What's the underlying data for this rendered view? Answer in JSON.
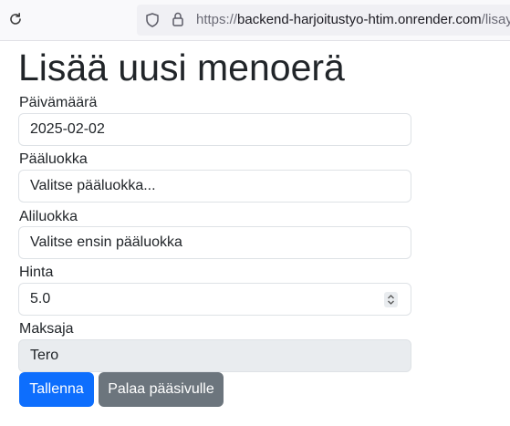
{
  "browser": {
    "url_prefix": "https://",
    "url_host": "backend-harjoitustyo-htim.onrender.com",
    "url_path": "/lisays"
  },
  "page": {
    "title": "Lisää uusi menoerä"
  },
  "form": {
    "date": {
      "label": "Päivämäärä",
      "value": "2025-02-02"
    },
    "main_category": {
      "label": "Pääluokka",
      "value": "Valitse pääluokka..."
    },
    "sub_category": {
      "label": "Aliluokka",
      "value": "Valitse ensin pääluokka"
    },
    "price": {
      "label": "Hinta",
      "value": "5.0"
    },
    "payer": {
      "label": "Maksaja",
      "value": "Tero"
    }
  },
  "buttons": {
    "save": "Tallenna",
    "back": "Palaa pääsivulle"
  },
  "colors": {
    "primary": "#0d6efd",
    "secondary": "#6c757d",
    "disabled_bg": "#e9ecef"
  }
}
